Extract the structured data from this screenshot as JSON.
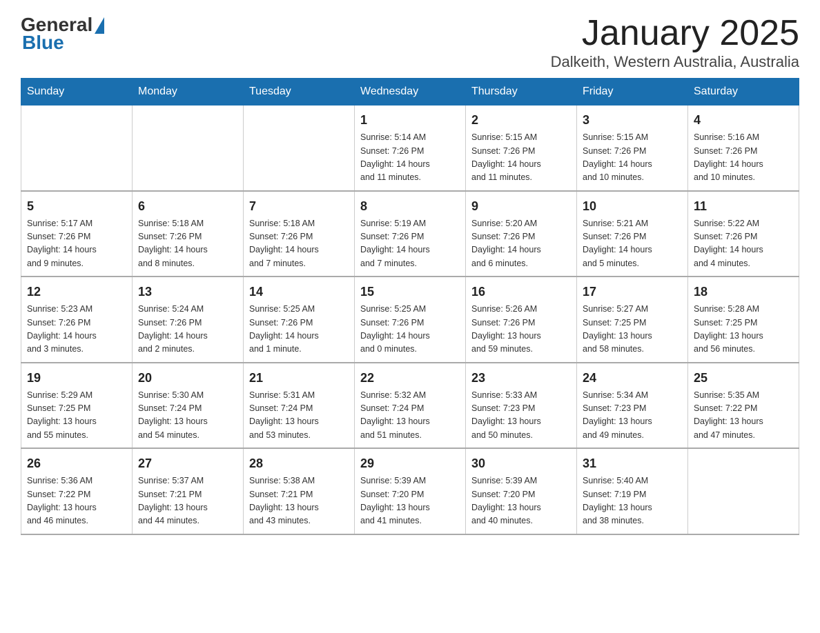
{
  "header": {
    "logo_general": "General",
    "logo_blue": "Blue",
    "title": "January 2025",
    "subtitle": "Dalkeith, Western Australia, Australia"
  },
  "days_of_week": [
    "Sunday",
    "Monday",
    "Tuesday",
    "Wednesday",
    "Thursday",
    "Friday",
    "Saturday"
  ],
  "weeks": [
    [
      {
        "day": "",
        "info": ""
      },
      {
        "day": "",
        "info": ""
      },
      {
        "day": "",
        "info": ""
      },
      {
        "day": "1",
        "info": "Sunrise: 5:14 AM\nSunset: 7:26 PM\nDaylight: 14 hours\nand 11 minutes."
      },
      {
        "day": "2",
        "info": "Sunrise: 5:15 AM\nSunset: 7:26 PM\nDaylight: 14 hours\nand 11 minutes."
      },
      {
        "day": "3",
        "info": "Sunrise: 5:15 AM\nSunset: 7:26 PM\nDaylight: 14 hours\nand 10 minutes."
      },
      {
        "day": "4",
        "info": "Sunrise: 5:16 AM\nSunset: 7:26 PM\nDaylight: 14 hours\nand 10 minutes."
      }
    ],
    [
      {
        "day": "5",
        "info": "Sunrise: 5:17 AM\nSunset: 7:26 PM\nDaylight: 14 hours\nand 9 minutes."
      },
      {
        "day": "6",
        "info": "Sunrise: 5:18 AM\nSunset: 7:26 PM\nDaylight: 14 hours\nand 8 minutes."
      },
      {
        "day": "7",
        "info": "Sunrise: 5:18 AM\nSunset: 7:26 PM\nDaylight: 14 hours\nand 7 minutes."
      },
      {
        "day": "8",
        "info": "Sunrise: 5:19 AM\nSunset: 7:26 PM\nDaylight: 14 hours\nand 7 minutes."
      },
      {
        "day": "9",
        "info": "Sunrise: 5:20 AM\nSunset: 7:26 PM\nDaylight: 14 hours\nand 6 minutes."
      },
      {
        "day": "10",
        "info": "Sunrise: 5:21 AM\nSunset: 7:26 PM\nDaylight: 14 hours\nand 5 minutes."
      },
      {
        "day": "11",
        "info": "Sunrise: 5:22 AM\nSunset: 7:26 PM\nDaylight: 14 hours\nand 4 minutes."
      }
    ],
    [
      {
        "day": "12",
        "info": "Sunrise: 5:23 AM\nSunset: 7:26 PM\nDaylight: 14 hours\nand 3 minutes."
      },
      {
        "day": "13",
        "info": "Sunrise: 5:24 AM\nSunset: 7:26 PM\nDaylight: 14 hours\nand 2 minutes."
      },
      {
        "day": "14",
        "info": "Sunrise: 5:25 AM\nSunset: 7:26 PM\nDaylight: 14 hours\nand 1 minute."
      },
      {
        "day": "15",
        "info": "Sunrise: 5:25 AM\nSunset: 7:26 PM\nDaylight: 14 hours\nand 0 minutes."
      },
      {
        "day": "16",
        "info": "Sunrise: 5:26 AM\nSunset: 7:26 PM\nDaylight: 13 hours\nand 59 minutes."
      },
      {
        "day": "17",
        "info": "Sunrise: 5:27 AM\nSunset: 7:25 PM\nDaylight: 13 hours\nand 58 minutes."
      },
      {
        "day": "18",
        "info": "Sunrise: 5:28 AM\nSunset: 7:25 PM\nDaylight: 13 hours\nand 56 minutes."
      }
    ],
    [
      {
        "day": "19",
        "info": "Sunrise: 5:29 AM\nSunset: 7:25 PM\nDaylight: 13 hours\nand 55 minutes."
      },
      {
        "day": "20",
        "info": "Sunrise: 5:30 AM\nSunset: 7:24 PM\nDaylight: 13 hours\nand 54 minutes."
      },
      {
        "day": "21",
        "info": "Sunrise: 5:31 AM\nSunset: 7:24 PM\nDaylight: 13 hours\nand 53 minutes."
      },
      {
        "day": "22",
        "info": "Sunrise: 5:32 AM\nSunset: 7:24 PM\nDaylight: 13 hours\nand 51 minutes."
      },
      {
        "day": "23",
        "info": "Sunrise: 5:33 AM\nSunset: 7:23 PM\nDaylight: 13 hours\nand 50 minutes."
      },
      {
        "day": "24",
        "info": "Sunrise: 5:34 AM\nSunset: 7:23 PM\nDaylight: 13 hours\nand 49 minutes."
      },
      {
        "day": "25",
        "info": "Sunrise: 5:35 AM\nSunset: 7:22 PM\nDaylight: 13 hours\nand 47 minutes."
      }
    ],
    [
      {
        "day": "26",
        "info": "Sunrise: 5:36 AM\nSunset: 7:22 PM\nDaylight: 13 hours\nand 46 minutes."
      },
      {
        "day": "27",
        "info": "Sunrise: 5:37 AM\nSunset: 7:21 PM\nDaylight: 13 hours\nand 44 minutes."
      },
      {
        "day": "28",
        "info": "Sunrise: 5:38 AM\nSunset: 7:21 PM\nDaylight: 13 hours\nand 43 minutes."
      },
      {
        "day": "29",
        "info": "Sunrise: 5:39 AM\nSunset: 7:20 PM\nDaylight: 13 hours\nand 41 minutes."
      },
      {
        "day": "30",
        "info": "Sunrise: 5:39 AM\nSunset: 7:20 PM\nDaylight: 13 hours\nand 40 minutes."
      },
      {
        "day": "31",
        "info": "Sunrise: 5:40 AM\nSunset: 7:19 PM\nDaylight: 13 hours\nand 38 minutes."
      },
      {
        "day": "",
        "info": ""
      }
    ]
  ]
}
